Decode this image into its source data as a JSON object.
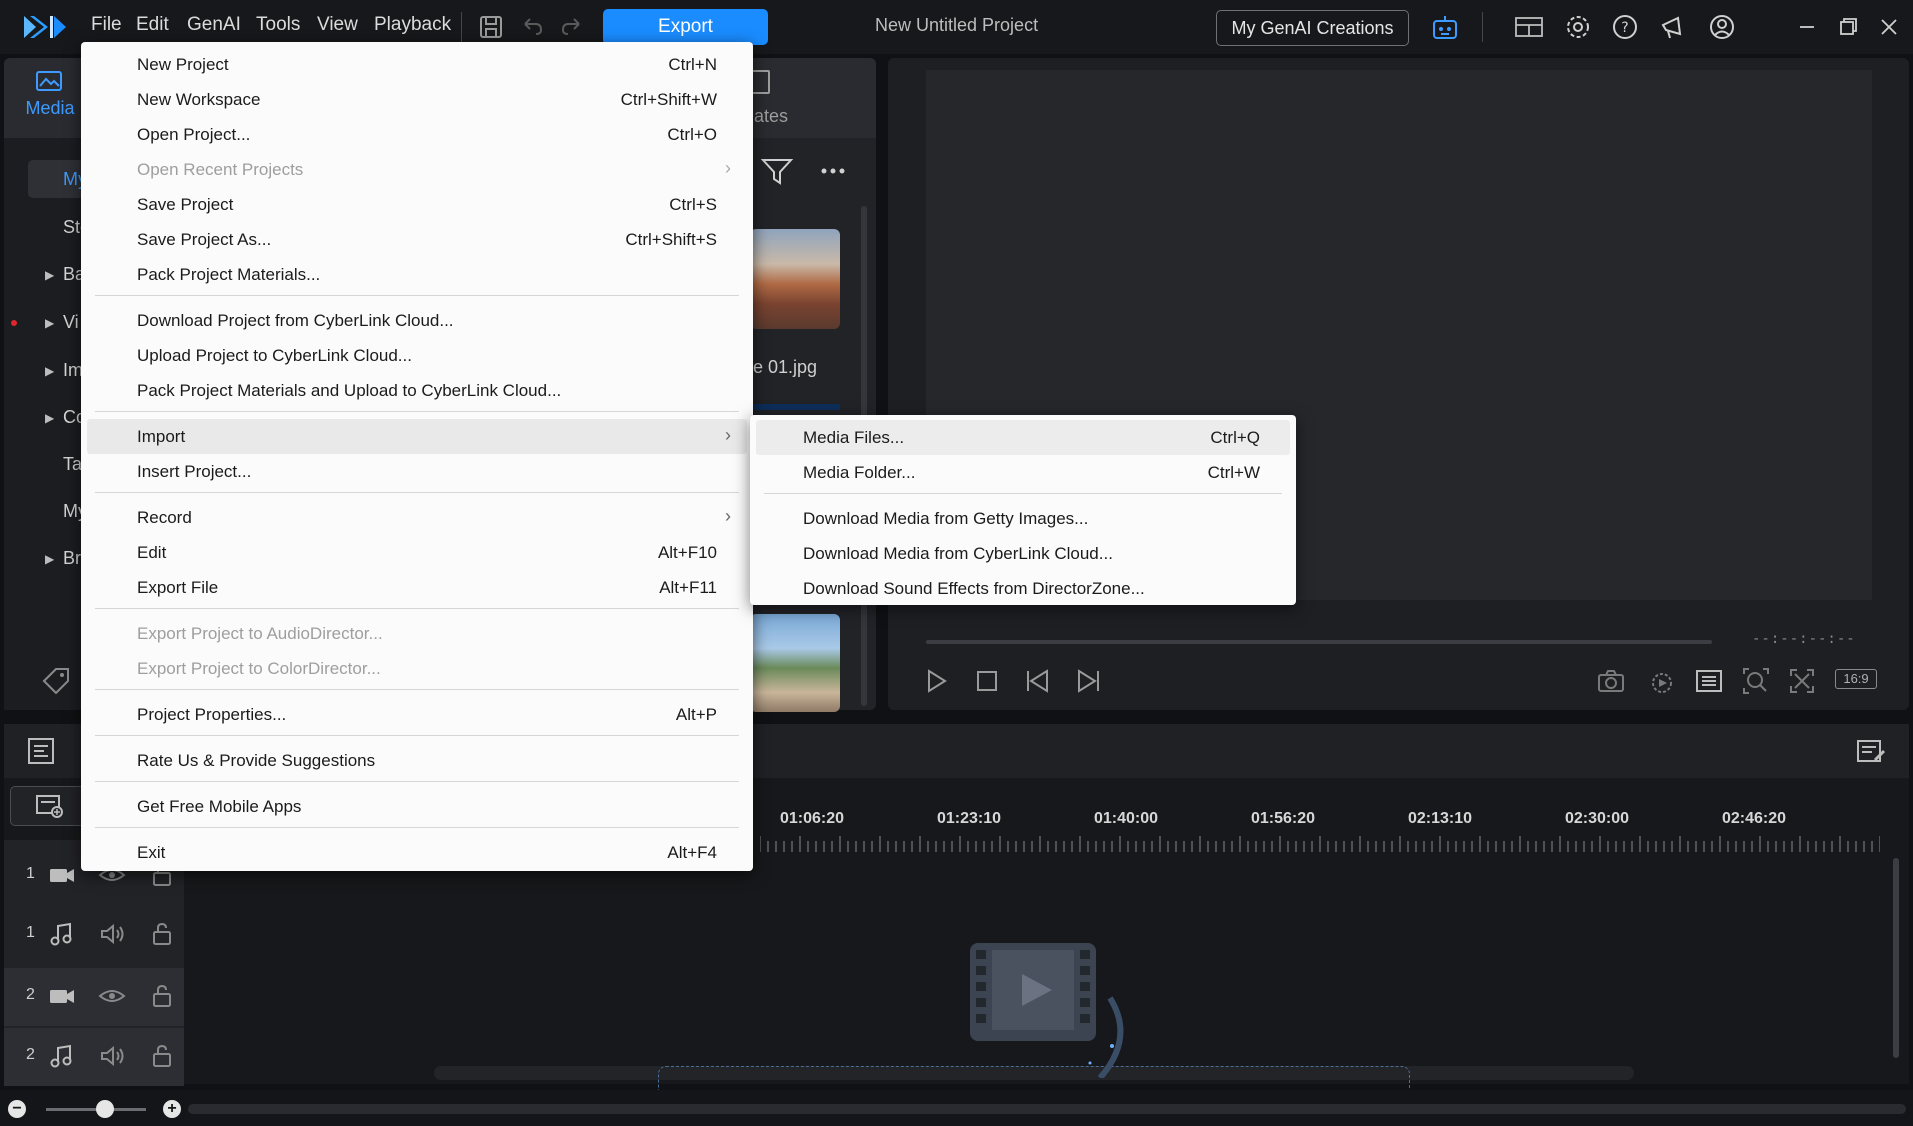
{
  "titlebar": {
    "menus": [
      "File",
      "Edit",
      "GenAI",
      "Tools",
      "View",
      "Playback"
    ],
    "export_label": "Export",
    "project_title": "New Untitled Project",
    "genai_label": "My GenAI Creations"
  },
  "library": {
    "media_tab": "Media",
    "templates_tab_partial": "plates",
    "tree_partial": [
      "My",
      "Sto",
      "Ba",
      "Vi",
      "Im",
      "Co",
      "Ta",
      "My",
      "Bra"
    ],
    "thumb_name_partial": "e 01.jpg"
  },
  "preview": {
    "timecode": "--:--:--:--",
    "aspect": "16:9"
  },
  "timeline": {
    "ruler": [
      "01:06:20",
      "01:23:10",
      "01:40:00",
      "01:56:20",
      "02:13:10",
      "02:30:00",
      "02:46:20"
    ],
    "tracks": [
      {
        "num": "1",
        "kind": "video"
      },
      {
        "num": "1",
        "kind": "audio"
      },
      {
        "num": "2",
        "kind": "video"
      },
      {
        "num": "2",
        "kind": "audio"
      }
    ]
  },
  "file_menu": {
    "items": [
      {
        "label": "New Project",
        "shortcut": "Ctrl+N"
      },
      {
        "label": "New Workspace",
        "shortcut": "Ctrl+Shift+W"
      },
      {
        "label": "Open Project...",
        "shortcut": "Ctrl+O"
      },
      {
        "label": "Open Recent Projects",
        "shortcut": ""
      },
      {
        "label": "Save Project",
        "shortcut": "Ctrl+S"
      },
      {
        "label": "Save Project As...",
        "shortcut": "Ctrl+Shift+S"
      },
      {
        "label": "Pack Project Materials...",
        "shortcut": ""
      },
      {
        "label": "Download Project from CyberLink Cloud...",
        "shortcut": ""
      },
      {
        "label": "Upload Project to CyberLink Cloud...",
        "shortcut": ""
      },
      {
        "label": "Pack Project Materials and Upload to CyberLink Cloud...",
        "shortcut": ""
      },
      {
        "label": "Import",
        "shortcut": ""
      },
      {
        "label": "Insert Project...",
        "shortcut": ""
      },
      {
        "label": "Record",
        "shortcut": ""
      },
      {
        "label": "Edit",
        "shortcut": "Alt+F10"
      },
      {
        "label": "Export File",
        "shortcut": "Alt+F11"
      },
      {
        "label": "Export Project to AudioDirector...",
        "shortcut": ""
      },
      {
        "label": "Export Project to ColorDirector...",
        "shortcut": ""
      },
      {
        "label": "Project Properties...",
        "shortcut": "Alt+P"
      },
      {
        "label": "Rate Us & Provide Suggestions",
        "shortcut": ""
      },
      {
        "label": "Get Free Mobile Apps",
        "shortcut": ""
      },
      {
        "label": "Exit",
        "shortcut": "Alt+F4"
      }
    ]
  },
  "import_submenu": {
    "items": [
      {
        "label": "Media Files...",
        "shortcut": "Ctrl+Q"
      },
      {
        "label": "Media Folder...",
        "shortcut": "Ctrl+W"
      },
      {
        "label": "Download Media from Getty Images...",
        "shortcut": ""
      },
      {
        "label": "Download Media from CyberLink Cloud...",
        "shortcut": ""
      },
      {
        "label": "Download Sound Effects from DirectorZone...",
        "shortcut": ""
      }
    ]
  },
  "colors": {
    "accent": "#1a8cff",
    "background": "#101114",
    "menu_bg": "#fbfbfb",
    "menu_highlight": "#e9e9ea"
  },
  "icons": [
    "app-logo-icon",
    "save-icon",
    "undo-icon",
    "redo-icon",
    "ai-robot-icon",
    "layout-icon",
    "gear-icon",
    "help-icon",
    "megaphone-icon",
    "account-icon",
    "minimize-icon",
    "restore-icon",
    "close-icon",
    "filter-icon",
    "more-icon",
    "play-icon",
    "stop-icon",
    "prev-frame-icon",
    "next-frame-icon",
    "snapshot-icon",
    "settings-loading-icon",
    "list-icon",
    "zoom-fit-icon",
    "fullscreen-icon",
    "tag-icon",
    "timeline-settings-icon",
    "add-track-icon",
    "edit-timeline-icon",
    "camera-icon",
    "music-icon",
    "eye-icon",
    "volume-icon",
    "lock-icon"
  ]
}
